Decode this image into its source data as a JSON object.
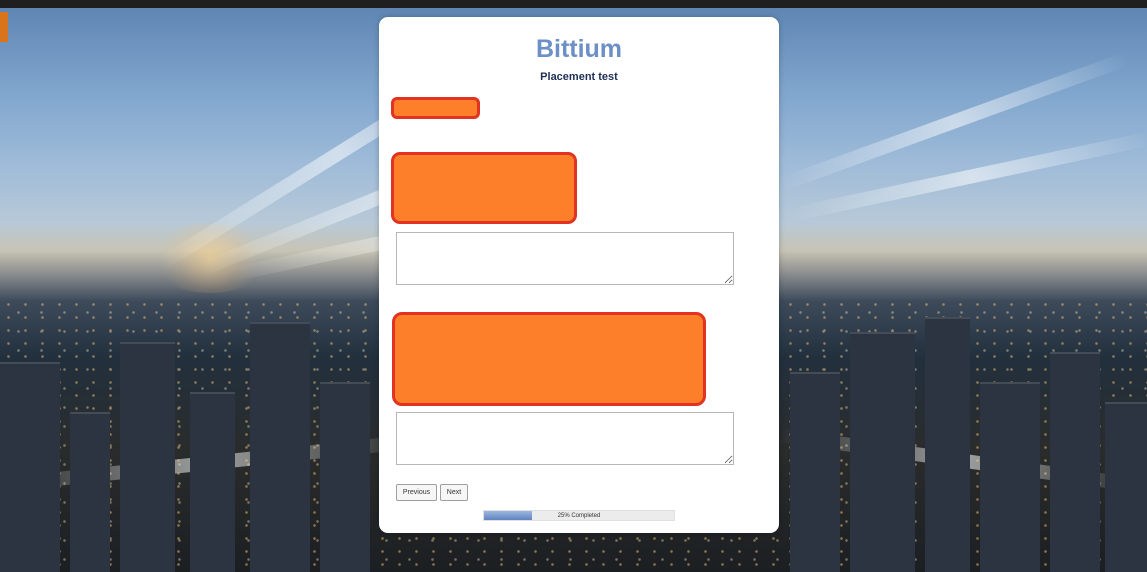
{
  "header": {
    "logo_text": "Bittium",
    "title": "Placement test"
  },
  "form": {
    "answer_1": {
      "value": ""
    },
    "answer_2": {
      "value": ""
    }
  },
  "navigation": {
    "previous_label": "Previous",
    "next_label": "Next"
  },
  "progress": {
    "value": 0.25,
    "label": "25% Completed"
  },
  "colors": {
    "brand": "#6b8fc6",
    "title": "#1d2f55",
    "redaction_fill": "#fd7f2a",
    "redaction_border": "#e23222"
  }
}
